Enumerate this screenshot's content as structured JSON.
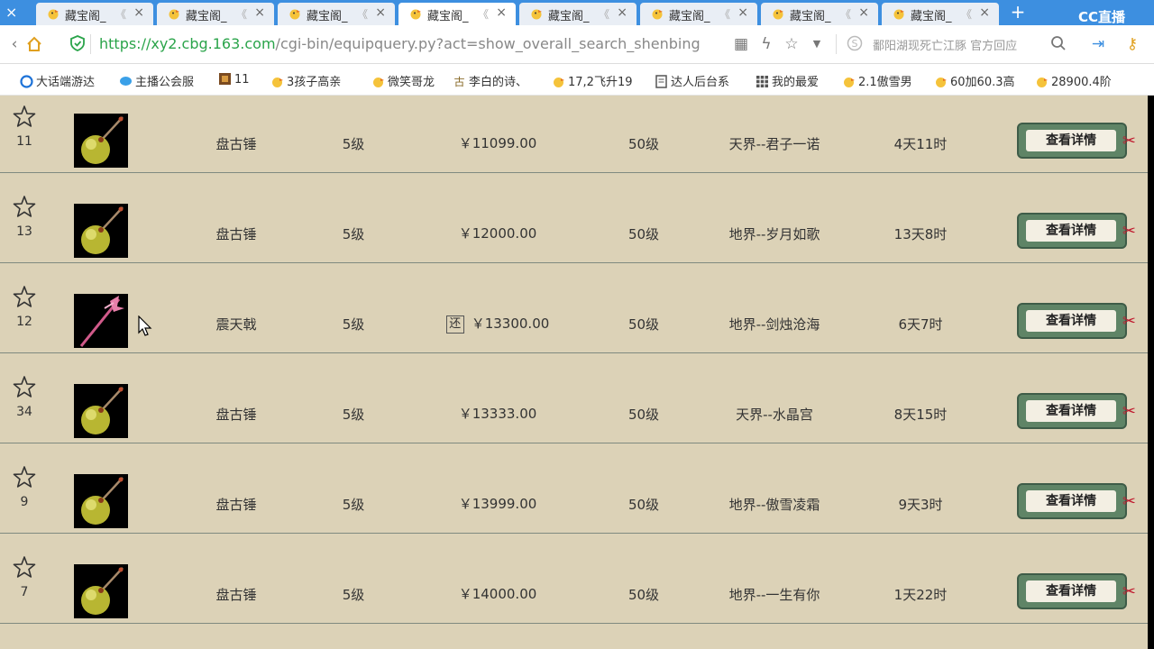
{
  "browser": {
    "tabs": [
      {
        "label": "藏宝阁_",
        "active": false
      },
      {
        "label": "藏宝阁_",
        "active": false
      },
      {
        "label": "藏宝阁_",
        "active": false
      },
      {
        "label": "藏宝阁_",
        "active": true
      },
      {
        "label": "藏宝阁_",
        "active": false
      },
      {
        "label": "藏宝阁_",
        "active": false
      },
      {
        "label": "藏宝阁_",
        "active": false
      },
      {
        "label": "藏宝阁_",
        "active": false
      }
    ],
    "moon": "《",
    "close_symbol": "×",
    "new_tab_symbol": "+",
    "logo_text": "CC直播",
    "url_host": "https://xy2.cbg.163.com",
    "url_path": "/cgi-bin/equipquery.py?act=show_overall_search_shenbing",
    "search_hint": "鄱阳湖现死亡江豚 官方回应",
    "accent": "#3d8fe0",
    "url_color": "#2aa44a"
  },
  "bookmarks": [
    {
      "label": "大话端游达",
      "icon": "ie-icon"
    },
    {
      "label": "主播公会服",
      "icon": "chat-icon"
    },
    {
      "label": "11",
      "icon": "game-icon"
    },
    {
      "label": "3孩子高亲",
      "icon": "chick-icon"
    },
    {
      "label": "微笑哥龙",
      "icon": "chick-icon"
    },
    {
      "label": "李白的诗、",
      "icon": "poem-icon"
    },
    {
      "label": "17,2飞升19",
      "icon": "chick-icon"
    },
    {
      "label": "达人后台系",
      "icon": "doc-icon"
    },
    {
      "label": "我的最爱",
      "icon": "grid-icon"
    },
    {
      "label": "2.1傲雪男",
      "icon": "chick-icon"
    },
    {
      "label": "60加60.3高",
      "icon": "chick-icon"
    },
    {
      "label": "28900.4阶",
      "icon": "chick-icon"
    }
  ],
  "listing": {
    "button_label": "查看详情",
    "return_badge": "还",
    "rows": [
      {
        "count": "11",
        "name": "盘古锤",
        "grade": "5级",
        "price": "￥11099.00",
        "level": "50级",
        "server": "天界--君子一诺",
        "time": "4天11时",
        "item_icon": "hammer-icon",
        "returnable": false
      },
      {
        "count": "13",
        "name": "盘古锤",
        "grade": "5级",
        "price": "￥12000.00",
        "level": "50级",
        "server": "地界--岁月如歌",
        "time": "13天8时",
        "item_icon": "hammer-icon",
        "returnable": false
      },
      {
        "count": "12",
        "name": "震天戟",
        "grade": "5级",
        "price": "￥13300.00",
        "level": "50级",
        "server": "地界--剑烛沧海",
        "time": "6天7时",
        "item_icon": "halberd-icon",
        "returnable": true
      },
      {
        "count": "34",
        "name": "盘古锤",
        "grade": "5级",
        "price": "￥13333.00",
        "level": "50级",
        "server": "天界--水晶宫",
        "time": "8天15时",
        "item_icon": "hammer-icon",
        "returnable": false
      },
      {
        "count": "9",
        "name": "盘古锤",
        "grade": "5级",
        "price": "￥13999.00",
        "level": "50级",
        "server": "地界--傲雪凌霜",
        "time": "9天3时",
        "item_icon": "hammer-icon",
        "returnable": false
      },
      {
        "count": "7",
        "name": "盘古锤",
        "grade": "5级",
        "price": "￥14000.00",
        "level": "50级",
        "server": "地界--一生有你",
        "time": "1天22时",
        "item_icon": "hammer-icon",
        "returnable": false
      }
    ]
  }
}
